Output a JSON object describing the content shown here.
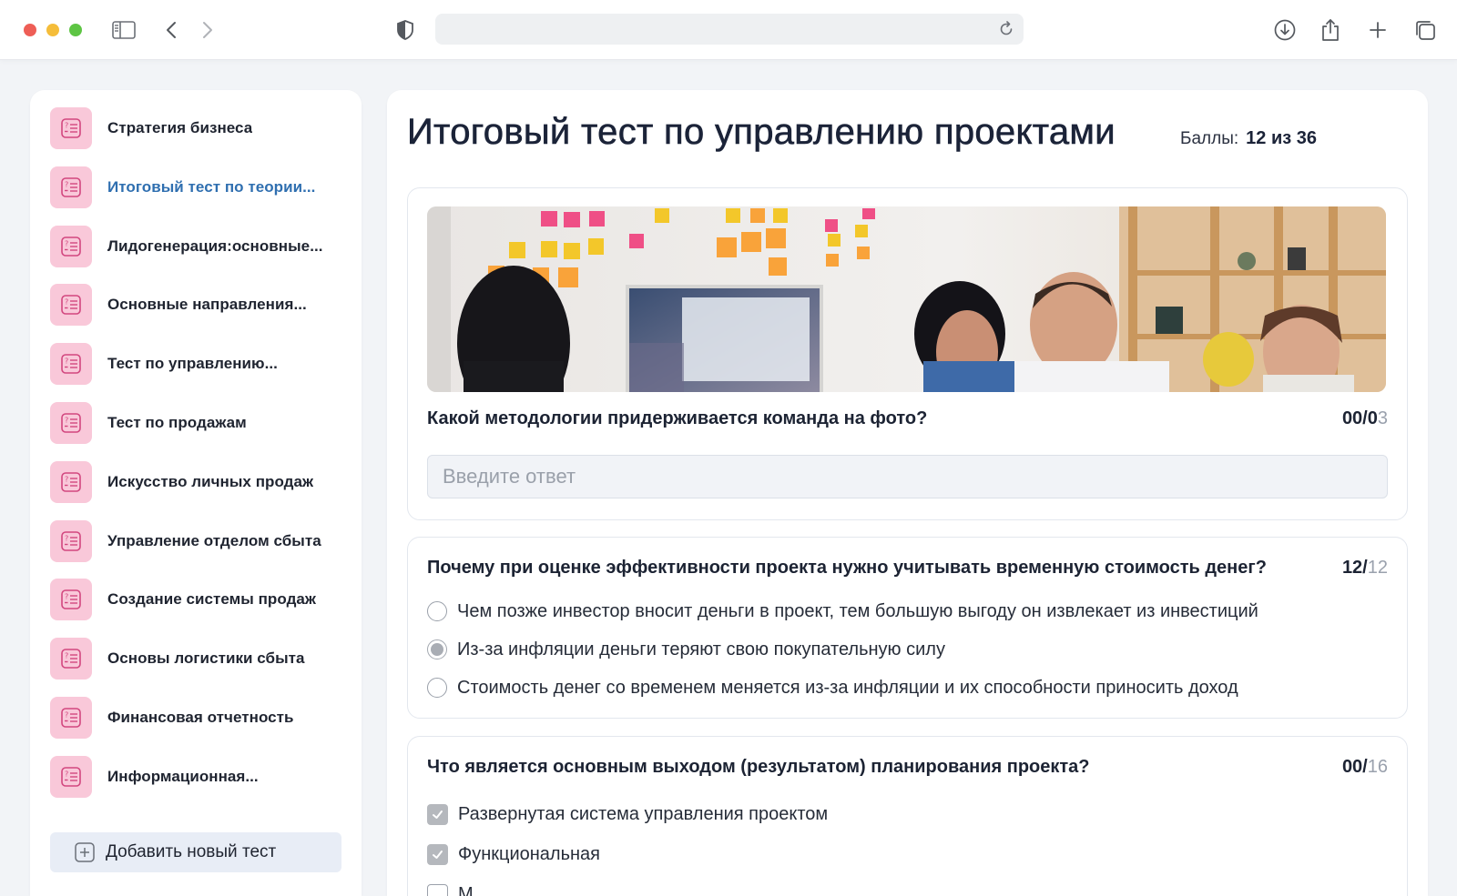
{
  "browser": {
    "url": "",
    "icons": [
      "sidebar-toggle-icon",
      "back-arrow-icon",
      "forward-arrow-icon",
      "shield-icon",
      "reload-icon",
      "download-icon",
      "share-icon",
      "new-tab-plus-icon",
      "tabs-overview-icon"
    ]
  },
  "sidebar": {
    "items": [
      {
        "label": "Стратегия бизнеса",
        "active": false
      },
      {
        "label": "Итоговый тест по теории...",
        "active": true
      },
      {
        "label": "Лидогенерация:основные...",
        "active": false
      },
      {
        "label": "Основные направления...",
        "active": false
      },
      {
        "label": "Тест по управлению...",
        "active": false
      },
      {
        "label": "Тест по продажам",
        "active": false
      },
      {
        "label": "Искусство личных продаж",
        "active": false
      },
      {
        "label": "Управление отделом сбыта",
        "active": false
      },
      {
        "label": "Создание системы продаж",
        "active": false
      },
      {
        "label": "Основы логистики сбыта",
        "active": false
      },
      {
        "label": "Финансовая отчетность",
        "active": false
      },
      {
        "label": "Информационная...",
        "active": false
      }
    ],
    "add_button_label": "Добавить новый тест"
  },
  "main": {
    "title": "Итоговый тест по управлению проектами",
    "score_label": "Баллы:",
    "score_value": "12 из 36",
    "questions": [
      {
        "text": "Какой методологии придерживается команда на фото?",
        "score": "00/0",
        "max": "3",
        "type": "text",
        "placeholder": "Введите ответ"
      },
      {
        "text": "Почему при оценке эффективности проекта нужно учитывать временную стоимость денег?",
        "score": "12/",
        "max": "12",
        "type": "radio",
        "options": [
          {
            "label": "Чем позже инвестор вносит деньги в проект, тем большую выгоду он извлекает из инвестиций",
            "selected": false
          },
          {
            "label": "Из-за инфляции деньги теряют свою покупательную силу",
            "selected": true
          },
          {
            "label": "Стоимость денег со временем меняется из-за инфляции и их способности приносить доход",
            "selected": false
          }
        ]
      },
      {
        "text": "Что является основным выходом (результатом) планирования проекта?",
        "score": "00/",
        "max": "16",
        "type": "checkbox",
        "options": [
          {
            "label": "Развернутая система управления проектом",
            "checked": true
          },
          {
            "label": "Функциональная",
            "checked": true
          },
          {
            "label": "М",
            "checked": false
          }
        ]
      }
    ]
  },
  "colors": {
    "accent_link": "#2f6fb0",
    "icon_tile": "#f9c8d9",
    "icon_stroke": "#d2477f",
    "add_button_bg": "#e8edf6",
    "checkbox_checked": "#b5b8bd"
  }
}
